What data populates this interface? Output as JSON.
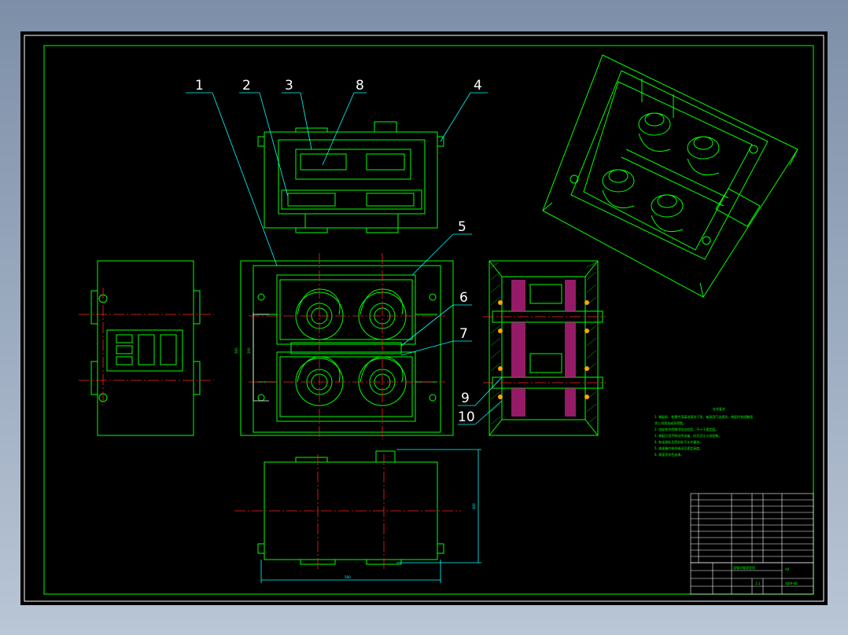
{
  "colors": {
    "background_top": "#7d8fa8",
    "background_bottom": "#b9c6d6",
    "sheet": "#000000",
    "outline": "#00ff00",
    "white_line": "#ffffff",
    "center_line": "#ff2020",
    "dimension": "#00ffff",
    "section_fill": "#b0207a"
  },
  "part_labels": [
    "1",
    "2",
    "3",
    "8",
    "4",
    "5",
    "6",
    "7",
    "9",
    "10"
  ],
  "dimensions": {
    "height_overall": "565",
    "height_inner": "200",
    "depth": "400",
    "width_bottom": "560"
  },
  "technical_requirements": {
    "title": "技术要求",
    "lines": [
      "1. 装配前，各零件用煤油清洗干净，轴承用汽油清洗，装配时各接触面",
      "   涂上润滑油或润滑脂。",
      "2. 齿轮啮合侧隙用铅丝检验，不小于规定值。",
      "3. 装配后用手转动传动轴，应灵活无卡滞现象。",
      "4. 各连接处及密封处不允许漏油。",
      "5. 减速箱内装机械油至规定高度。",
      "6. 表面涂灰色油漆。"
    ]
  },
  "title_block": {
    "drawing_title": "双辊对辊成型机",
    "drawing_number": "XJ09-00",
    "scale": "1:1",
    "sheet": "A0"
  }
}
